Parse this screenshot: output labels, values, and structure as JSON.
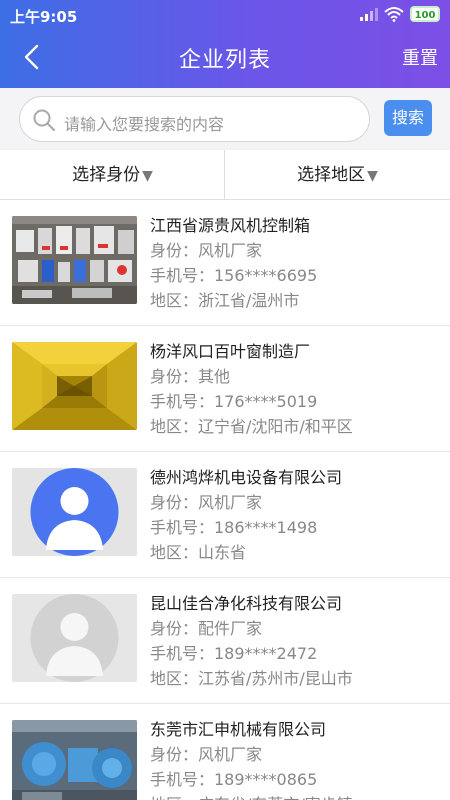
{
  "status": {
    "time": "上午9:05",
    "battery": "100"
  },
  "nav": {
    "title": "企业列表",
    "reset_label": "重置"
  },
  "search": {
    "placeholder": "请输入您要搜索的内容",
    "button_label": "搜索"
  },
  "filters": {
    "identity": "选择身份",
    "region": "选择地区"
  },
  "items": [
    {
      "name": "江西省源贵风机控制箱",
      "identity": "身份：风机厂家",
      "phone": "手机号：156****6695",
      "region": "地区：浙江省/温州市"
    },
    {
      "name": "杨洋风口百叶窗制造厂",
      "identity": "身份：其他",
      "phone": "手机号：176****5019",
      "region": "地区：辽宁省/沈阳市/和平区"
    },
    {
      "name": "德州鸿烨机电设备有限公司",
      "identity": "身份：风机厂家",
      "phone": "手机号：186****1498",
      "region": "地区：山东省"
    },
    {
      "name": "昆山佳合净化科技有限公司",
      "identity": "身份：配件厂家",
      "phone": "手机号：189****2472",
      "region": "地区：江苏省/苏州市/昆山市"
    },
    {
      "name": "东莞市汇申机械有限公司",
      "identity": "身份：风机厂家",
      "phone": "手机号：189****0865",
      "region": "地区：广东省/东莞市/寮步镇"
    }
  ],
  "colors": {
    "header_start": "#3d6ee6",
    "header_end": "#7d4fe6",
    "search_button": "#4a8ef0"
  }
}
